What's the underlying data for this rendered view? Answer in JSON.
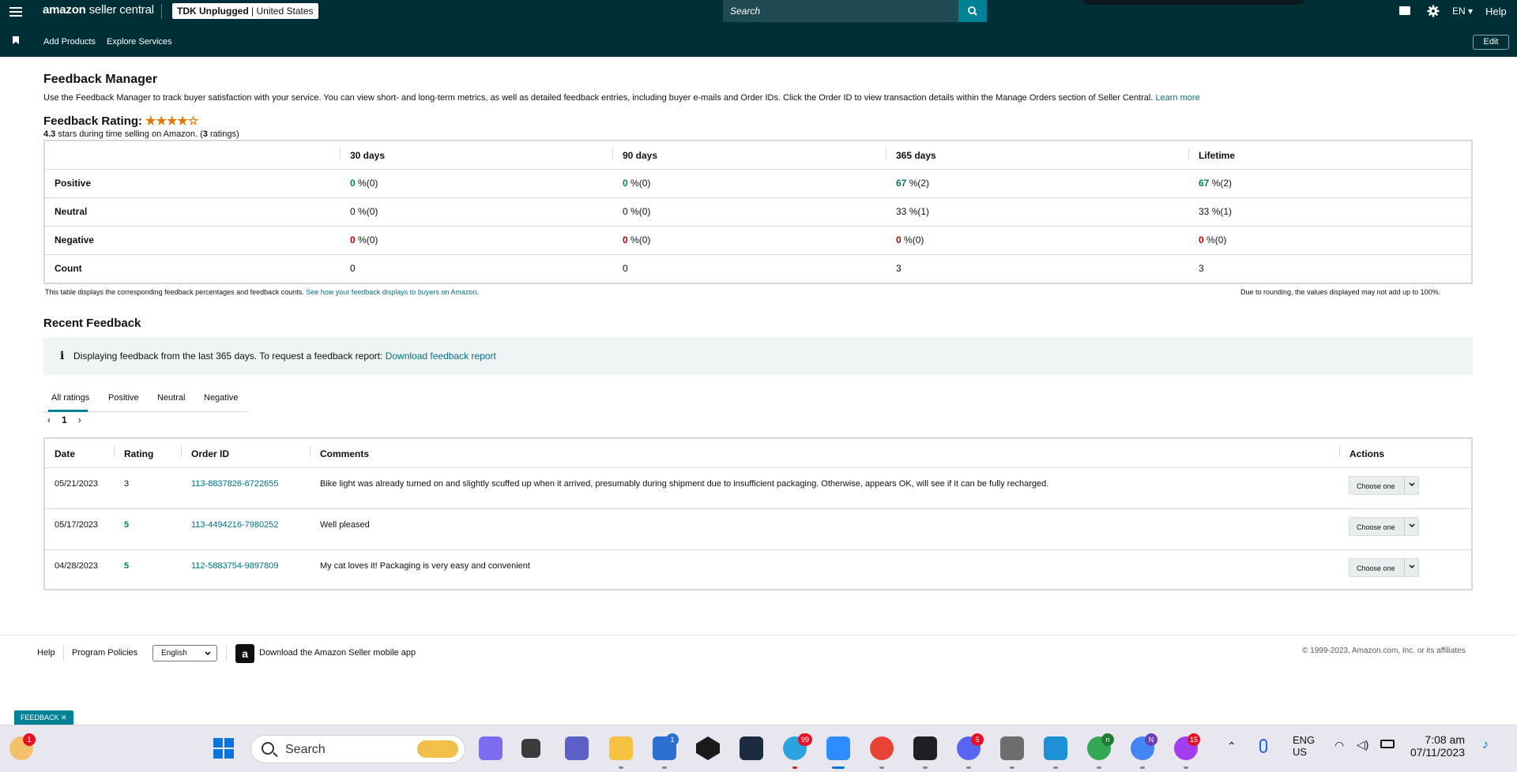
{
  "header": {
    "brand_light": "amazon",
    "brand_rest": " seller central",
    "store_name": "TDK Unplugged",
    "store_country": "United States",
    "search_placeholder": "Search",
    "language": "EN ▾",
    "help": "Help"
  },
  "subnav": {
    "add_products": "Add Products",
    "explore_services": "Explore Services",
    "edit": "Edit"
  },
  "page": {
    "title": "Feedback Manager",
    "intro": "Use the Feedback Manager to track buyer satisfaction with your service. You can view short- and long-term metrics, as well as detailed feedback entries, including buyer e-mails and Order IDs. Click the Order ID to view transaction details within the Manage Orders section of Seller Central.",
    "learn_more": "Learn more",
    "rating_label": "Feedback Rating:",
    "stars": "★★★★☆",
    "rating_value": "4.3",
    "rating_text": "stars during time selling on Amazon. (",
    "rating_count": "3",
    "rating_suffix": " ratings)"
  },
  "metrics": {
    "columns": [
      "30 days",
      "90 days",
      "365 days",
      "Lifetime"
    ],
    "rows": [
      {
        "label": "Positive",
        "cells": [
          [
            "0",
            " %(0)"
          ],
          [
            "0",
            " %(0)"
          ],
          [
            "67",
            " %(2)"
          ],
          [
            "67",
            " %(2)"
          ]
        ]
      },
      {
        "label": "Neutral",
        "cells": [
          [
            "0",
            " %(0)"
          ],
          [
            "0",
            " %(0)"
          ],
          [
            "33",
            " %(1)"
          ],
          [
            "33",
            " %(1)"
          ]
        ]
      },
      {
        "label": "Negative",
        "cells": [
          [
            "0",
            " %(0)"
          ],
          [
            "0",
            " %(0)"
          ],
          [
            "0",
            " %(0)"
          ],
          [
            "0",
            " %(0)"
          ]
        ]
      },
      {
        "label": "Count",
        "cells": [
          [
            "0",
            ""
          ],
          [
            "0",
            ""
          ],
          [
            "3",
            ""
          ],
          [
            "3",
            ""
          ]
        ]
      }
    ],
    "note_left": "This table displays the corresponding feedback percentages and feedback counts.",
    "note_link": "See how your feedback displays to buyers on Amazon.",
    "note_right": "Due to rounding, the values displayed may not add up to 100%."
  },
  "recent": {
    "title": "Recent Feedback",
    "info_text": "Displaying feedback from the last 365 days. To request a feedback report:",
    "info_link": "Download feedback report",
    "tabs": [
      "All ratings",
      "Positive",
      "Neutral",
      "Negative"
    ],
    "page_number": "1",
    "columns": [
      "Date",
      "Rating",
      "Order ID",
      "Comments",
      "Actions"
    ],
    "rows": [
      {
        "date": "05/21/2023",
        "rating": "3",
        "order_id": "113-8837826-6722655",
        "comment": "Bike light was already turned on and slightly scuffed up when it arrived, presumably during shipment due to insufficient packaging. Otherwise, appears OK, will see if it can be fully recharged.",
        "action": "Choose one"
      },
      {
        "date": "05/17/2023",
        "rating": "5",
        "order_id": "113-4494216-7980252",
        "comment": "Well pleased",
        "action": "Choose one"
      },
      {
        "date": "04/28/2023",
        "rating": "5",
        "order_id": "112-5883754-9897809",
        "comment": "My cat loves it! Packaging is very easy and convenient",
        "action": "Choose one"
      }
    ]
  },
  "footer": {
    "help": "Help",
    "program_policies": "Program Policies",
    "language": "English",
    "app_link": "Download the Amazon Seller mobile app",
    "copyright": "© 1999-2023, Amazon.com, Inc. or its affiliates",
    "feedback_pill": "FEEDBACK ✕"
  },
  "taskbar": {
    "search_text": "Search",
    "badges": {
      "weather": "1",
      "store": "1",
      "telegram": "99",
      "discord": "5",
      "chrome_n": "n",
      "chrome_profile": "N",
      "messenger": "15"
    },
    "lang_line1": "ENG",
    "lang_line2": "US",
    "time": "7:08 am",
    "date": "07/11/2023"
  },
  "colors": {
    "nav_bg": "#002f36",
    "accent": "#008296",
    "link": "#007185",
    "positive": "#067d62",
    "negative": "#c40000",
    "star": "#e77600"
  }
}
